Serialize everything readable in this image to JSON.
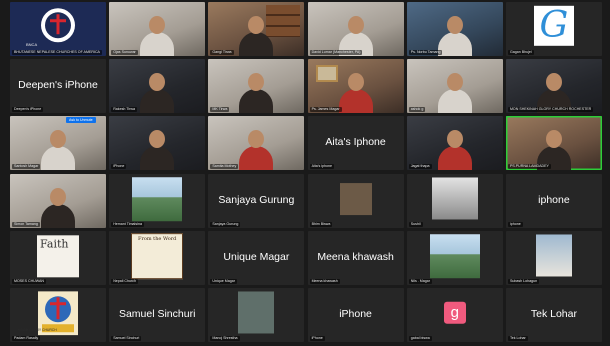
{
  "meeting": {
    "participants": [
      {
        "label": "BHUTANESE NEPALESE CHURCHES OF AMERICA",
        "display_text": "",
        "kind": "logo",
        "logo_caption": "BNCA"
      },
      {
        "label": "Ojas Sunuwar",
        "display_text": "",
        "kind": "video"
      },
      {
        "label": "Gangi Tirwa",
        "display_text": "",
        "kind": "video"
      },
      {
        "label": "David Lumar (Manchester, PA)",
        "display_text": "",
        "kind": "video"
      },
      {
        "label": "Ps. Norbu Tamang",
        "display_text": "",
        "kind": "video"
      },
      {
        "label": "Gagan Bhujel",
        "display_text": "",
        "kind": "avatar-g",
        "avatar_letter": "G"
      },
      {
        "label": "Deepen's iPhone",
        "display_text": "Deepen's iPhone",
        "kind": "name"
      },
      {
        "label": "Rakesh Tirwa",
        "display_text": "",
        "kind": "video"
      },
      {
        "label": "MK Tirwa",
        "display_text": "",
        "kind": "video"
      },
      {
        "label": "Ps. James Magar",
        "display_text": "",
        "kind": "video"
      },
      {
        "label": "ashok g",
        "display_text": "",
        "kind": "video"
      },
      {
        "label": "MON SHEKINAH GLORY CHURCH ROCHESTER",
        "display_text": "",
        "kind": "video"
      },
      {
        "label": "Santosh Magar",
        "display_text": "",
        "kind": "video",
        "badge": "Ask to Unmute"
      },
      {
        "label": "iPhone",
        "display_text": "",
        "kind": "video"
      },
      {
        "label": "Samita Mothey",
        "display_text": "",
        "kind": "video"
      },
      {
        "label": "Aita's iphone",
        "display_text": "Aita's Iphone",
        "kind": "name"
      },
      {
        "label": "Jagat thapa",
        "display_text": "",
        "kind": "video"
      },
      {
        "label": "PS.PURNA LAMDADEY",
        "display_text": "",
        "kind": "video"
      },
      {
        "label": "Simon Tamang",
        "display_text": "",
        "kind": "video"
      },
      {
        "label": "Hemant Timalsina",
        "display_text": "",
        "kind": "photo"
      },
      {
        "label": "Sanjaya Gurung",
        "display_text": "Sanjaya Gurung",
        "kind": "name"
      },
      {
        "label": "Bhim Biswa",
        "display_text": "",
        "kind": "photo"
      },
      {
        "label": "Sushil",
        "display_text": "",
        "kind": "photo"
      },
      {
        "label": "iphone",
        "display_text": "iphone",
        "kind": "name"
      },
      {
        "label": "MOSES CHUWAN",
        "display_text": "",
        "kind": "faith",
        "image_text": "Faith"
      },
      {
        "label": "Nepali Church",
        "display_text": "",
        "kind": "book",
        "image_text": "From the Word"
      },
      {
        "label": "Unique Magar",
        "display_text": "Unique Magar",
        "kind": "name"
      },
      {
        "label": "Meena khawash",
        "display_text": "Meena khawash",
        "kind": "name"
      },
      {
        "label": "Nils . Magar",
        "display_text": "",
        "kind": "photo"
      },
      {
        "label": "Subash Lohagun",
        "display_text": "",
        "kind": "photo"
      },
      {
        "label": "Padam Rasaily",
        "display_text": "",
        "kind": "church",
        "logo_caption": "KINAH GLORY CHURCH"
      },
      {
        "label": "Samuel Sinchuri",
        "display_text": "Samuel Sinchuri",
        "kind": "name"
      },
      {
        "label": "Manoj Shrestha",
        "display_text": "",
        "kind": "photo"
      },
      {
        "label": "iPhone",
        "display_text": "iPhone",
        "kind": "name"
      },
      {
        "label": "gabal biswa",
        "display_text": "",
        "kind": "avatar-pink",
        "avatar_letter": "g"
      },
      {
        "label": "Tek Lohar",
        "display_text": "Tek Lohar",
        "kind": "name"
      }
    ]
  },
  "colors": {
    "background": "#1a1a1a",
    "tile": "#262626",
    "active_speaker_border": "#2dce38",
    "unmute_badge": "#0e72ed"
  }
}
